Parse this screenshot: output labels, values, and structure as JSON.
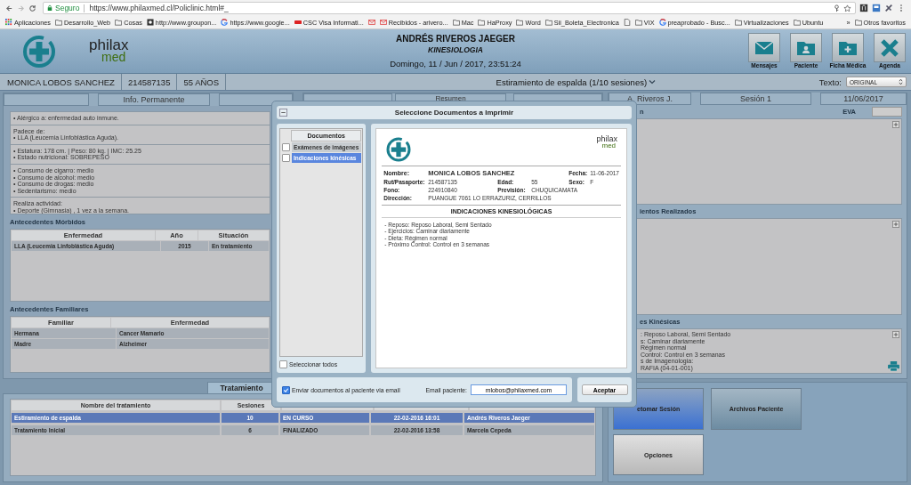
{
  "browser": {
    "secure_label": "Seguro",
    "url": "https://www.philaxmed.cl/Policlinic.html#_",
    "bookmarks": [
      {
        "kind": "apps",
        "label": "Aplicaciones"
      },
      {
        "kind": "folder",
        "label": "Desarrollo_Web"
      },
      {
        "kind": "folder",
        "label": "Cosas"
      },
      {
        "kind": "page",
        "label": "http://www.groupon..."
      },
      {
        "kind": "google",
        "label": "https://www.google..."
      },
      {
        "kind": "badge",
        "label": "CSC Visa Informati..."
      },
      {
        "kind": "mail"
      },
      {
        "kind": "mail",
        "label": "Recibidos - arivero..."
      },
      {
        "kind": "folder",
        "label": "Mac"
      },
      {
        "kind": "folder",
        "label": "HaProxy"
      },
      {
        "kind": "folder",
        "label": "Word"
      },
      {
        "kind": "folder",
        "label": "Sii_Boleta_Electronica"
      },
      {
        "kind": "file"
      },
      {
        "kind": "folder",
        "label": "VIX"
      },
      {
        "kind": "google",
        "label": "preaprobado - Busc..."
      },
      {
        "kind": "folder",
        "label": "Virtualizaciones"
      },
      {
        "kind": "folder",
        "label": "Ubuntu"
      }
    ],
    "more": "»",
    "other_bookmarks": "Otros favoritos"
  },
  "header": {
    "logo": {
      "top": "philax",
      "bottom": "med"
    },
    "doctor": "ANDRÉS RIVEROS JAEGER",
    "specialty": "KINESIOLOGIA",
    "datetime": "Domingo, 11 / Jun / 2017, 23:51:24",
    "actions": [
      {
        "kind": "mail",
        "label": "Mensajes"
      },
      {
        "kind": "person",
        "label": "Paciente"
      },
      {
        "kind": "add",
        "label": "Ficha Médica"
      },
      {
        "kind": "close",
        "label": "Agenda"
      }
    ]
  },
  "patient_bar": {
    "name": "MONICA LOBOS SANCHEZ",
    "rut": "214587135",
    "age": "55 AÑOS",
    "treatment": "Estiramiento de espalda (1/10 sesiones)",
    "text_label": "Texto:",
    "text_value": "ORIGINAL"
  },
  "left_panel": {
    "tab": "Info. Permanente",
    "info_blocks": [
      [
        "• Alérgico a: enfermedad auto inmune."
      ],
      [
        "Padece de:",
        "• LLA (Leucemia Linfoblástica Aguda)."
      ],
      [
        "• Estatura: 178 cm. | Peso: 80 kg. | IMC: 25.25",
        "• Estado nutricional: SOBREPESO"
      ],
      [
        "• Consumo de cigarro: medio",
        "• Consumo de alcohol: medio",
        "• Consumo de drogas: medio",
        "• Sedentarismo: medio"
      ],
      [
        "Realiza actividad:",
        "• Deporte (Gimnasia) , 1 vez a la semana."
      ]
    ],
    "morbid": {
      "title": "Antecedentes Mórbidos",
      "columns": [
        "Enfermedad",
        "Año",
        "Situación"
      ],
      "rows": [
        [
          "LLA (Leucemia Linfoblástica Aguda)",
          "2015",
          "En tratamiento"
        ]
      ]
    },
    "family": {
      "title": "Antecedentes Familiares",
      "columns": [
        "Familiar",
        "Enfermedad"
      ],
      "rows": [
        [
          "Hermana",
          "Cancer Mamario"
        ],
        [
          "Madre",
          "Alzheimer"
        ]
      ]
    }
  },
  "middle_panel": {
    "tab": "Resumen"
  },
  "right_panel": {
    "tabs": [
      "A. Riveros J.",
      "Sesión 1",
      "11/06/2017"
    ],
    "sections": [
      {
        "label": "n",
        "eva_label": "EVA"
      },
      {
        "label": "ientos Realizados"
      },
      {
        "label": "es Kinésicas",
        "printable": true,
        "lines": [
          ": Reposo Laboral, Semi Sentado",
          "s: Caminar diariamente",
          "Régimen normal",
          "Control: Control en 3 semanas",
          "s de Imagenologia:",
          "RAFIA (04-01-001)"
        ]
      }
    ]
  },
  "session_actions": [
    {
      "kind": "active",
      "label": "etomar Sesión"
    },
    {
      "kind": "dark",
      "label": "Archivos Paciente"
    },
    {
      "kind": "light",
      "label": "Opciones"
    }
  ],
  "treatments": {
    "tab": "Tratamiento",
    "columns": [
      "Nombre del tratamiento",
      "Sesiones"
    ],
    "rows": [
      {
        "selected": true,
        "cells": [
          "Estiramiento de espalda",
          "10",
          "EN CURSO",
          "22-02-2016 16:01",
          "Andrés Riveros Jaeger"
        ]
      },
      {
        "selected": false,
        "cells": [
          "Tratamiento Inicial",
          "6",
          "FINALIZADO",
          "22-02-2016 13:58",
          "Marcela Cepeda"
        ]
      }
    ]
  },
  "dialog": {
    "title": "Seleccione Documentos a Imprimir",
    "list_header": "Documentos",
    "documents": [
      {
        "label": "Exámenes de imágenes",
        "checked": false,
        "selected": false
      },
      {
        "label": "Indicaciones kinésicas",
        "checked": false,
        "selected": true
      }
    ],
    "select_all": {
      "label": "Seleccionar todos",
      "checked": false
    },
    "preview": {
      "logo": {
        "top": "philax",
        "bottom": "med"
      },
      "rows": [
        [
          {
            "kind": "main",
            "label": "Nombre:",
            "value": "MONICA LOBOS SANCHEZ"
          },
          {
            "kind": "plain",
            "label": "Fecha:",
            "value": "11-06-2017"
          }
        ],
        [
          {
            "kind": "plain",
            "label": "Rut/Pasaporte:",
            "value": "214587135"
          },
          {
            "kind": "plain",
            "label": "Edad:",
            "value": "55"
          },
          {
            "kind": "plain",
            "label": "Sexo:",
            "value": "F"
          }
        ],
        [
          {
            "kind": "plain",
            "label": "Fono:",
            "value": "224910840"
          },
          {
            "kind": "plain",
            "label": "Previsión:",
            "value": "CHUQUICAMATA"
          }
        ],
        [
          {
            "kind": "plain",
            "label": "Dirección:",
            "value": "PUANGUE 7061 LO ERRAZURIZ, CERRILLOS"
          }
        ]
      ],
      "heading": "INDICACIONES KINESIOLÓGICAS",
      "lines": [
        "- Reposo: Reposo Laboral, Semi Sentado",
        "- Ejercicios: Caminar diariamente",
        "- Dieta: Régimen normal",
        "- Próximo Control: Control en 3 semanas"
      ]
    },
    "email_option": {
      "label": "Enviar documentos al paciente via email",
      "checked": true
    },
    "email_label": "Email paciente:",
    "email_value": "mlobos@philaxmed.com",
    "accept": "Aceptar"
  }
}
